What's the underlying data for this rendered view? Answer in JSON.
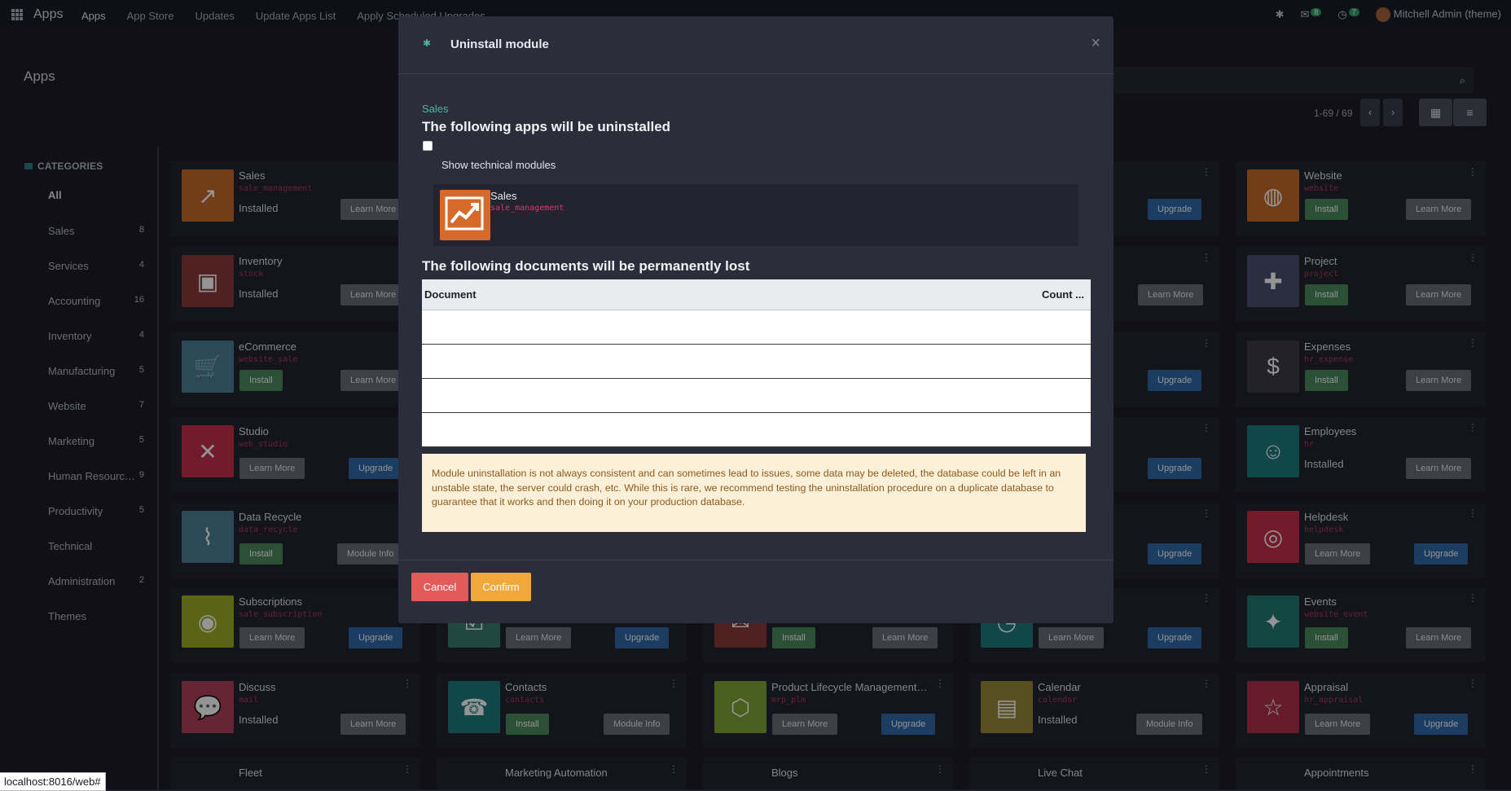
{
  "topnav": {
    "brand": "Apps",
    "items": [
      "Apps",
      "App Store",
      "Updates",
      "Update Apps List",
      "Apply Scheduled Upgrades"
    ],
    "messages_badge": "8",
    "activity_badge": "7",
    "user": "Mitchell Admin (theme)"
  },
  "control_panel": {
    "title": "Apps",
    "pager": "1-69 / 69"
  },
  "sidebar": {
    "heading": "CATEGORIES",
    "items": [
      {
        "label": "All",
        "count": ""
      },
      {
        "label": "Sales",
        "count": "8"
      },
      {
        "label": "Services",
        "count": "4"
      },
      {
        "label": "Accounting",
        "count": "16"
      },
      {
        "label": "Inventory",
        "count": "4"
      },
      {
        "label": "Manufacturing",
        "count": "5"
      },
      {
        "label": "Website",
        "count": "7"
      },
      {
        "label": "Marketing",
        "count": "5"
      },
      {
        "label": "Human Resourc…",
        "count": "9"
      },
      {
        "label": "Productivity",
        "count": "5"
      },
      {
        "label": "Technical",
        "count": ""
      },
      {
        "label": "Administration",
        "count": "2"
      },
      {
        "label": "Themes",
        "count": ""
      }
    ]
  },
  "apps": {
    "sales": {
      "name": "Sales",
      "tech": "sale_management",
      "status": "Installed",
      "b1": "Learn More"
    },
    "inventory": {
      "name": "Inventory",
      "tech": "stock",
      "status": "Installed",
      "b1": "Learn More"
    },
    "ecommerce": {
      "name": "eCommerce",
      "tech": "website_sale",
      "b1": "Install",
      "b2": "Learn More"
    },
    "studio": {
      "name": "Studio",
      "tech": "web_studio",
      "b1": "Learn More",
      "b2": "Upgrade"
    },
    "datarecycle": {
      "name": "Data Recycle",
      "tech": "data_recycle",
      "b1": "Install",
      "b2": "Module Info"
    },
    "subscriptions": {
      "name": "Subscriptions",
      "tech": "sale_subscription",
      "b1": "Learn More",
      "b2": "Upgrade"
    },
    "discuss": {
      "name": "Discuss",
      "tech": "mail",
      "status": "Installed",
      "b1": "Learn More"
    },
    "contacts": {
      "name": "Contacts",
      "tech": "contacts",
      "b1": "Install",
      "b2": "Module Info"
    },
    "plm": {
      "name": "Product Lifecycle Management…",
      "tech": "mrp_plm",
      "b1": "Learn More",
      "b2": "Upgrade"
    },
    "calendar": {
      "name": "Calendar",
      "tech": "calendar",
      "status": "Installed",
      "b1": "Module Info"
    },
    "website": {
      "name": "Website",
      "tech": "website",
      "b1": "Install",
      "b2": "Learn More"
    },
    "project": {
      "name": "Project",
      "tech": "project",
      "b1": "Install",
      "b2": "Learn More"
    },
    "expenses": {
      "name": "Expenses",
      "tech": "hr_expense",
      "b1": "Install",
      "b2": "Learn More"
    },
    "employees": {
      "name": "Employees",
      "tech": "hr",
      "status": "Installed",
      "b1": "Learn More"
    },
    "helpdesk": {
      "name": "Helpdesk",
      "tech": "helpdesk",
      "b1": "Learn More",
      "b2": "Upgrade"
    },
    "events": {
      "name": "Events",
      "tech": "website_event",
      "b1": "Install",
      "b2": "Learn More"
    },
    "appraisal": {
      "name": "Appraisal",
      "tech": "hr_appraisal",
      "b1": "Learn More",
      "b2": "Upgrade"
    },
    "fleet": {
      "name": "Fleet"
    },
    "marketing_automation": {
      "name": "Marketing Automation"
    },
    "blogs": {
      "name": "Blogs"
    },
    "livechat": {
      "name": "Live Chat"
    },
    "appointments": {
      "name": "Appointments"
    },
    "partial": {
      "upgrade": "Upgrade",
      "learn": "Learn More",
      "install": "Install"
    }
  },
  "modal": {
    "title": "Uninstall module",
    "module_label": "Sales",
    "heading_apps": "The following apps will be uninstalled",
    "show_technical": "Show technical modules",
    "app_name": "Sales",
    "app_tech": "sale_management",
    "heading_docs": "The following documents will be permanently lost",
    "table_headers": [
      "Document",
      "Count ..."
    ],
    "warning": "Module uninstallation is not always consistent and can sometimes lead to issues, some data may be deleted, the database could be left in an unstable state, the server could crash, etc. While this is rare, we recommend testing the uninstallation procedure on a duplicate database to guarantee that it works and then doing it on your production database.",
    "cancel": "Cancel",
    "confirm": "Confirm"
  },
  "statusbar": "localhost:8016/web#",
  "colors": {
    "accent_teal": "#4fb89a",
    "cancel_red": "#e45a5a",
    "confirm_orange": "#f0a83b",
    "warning_bg": "#fdf0d9"
  }
}
